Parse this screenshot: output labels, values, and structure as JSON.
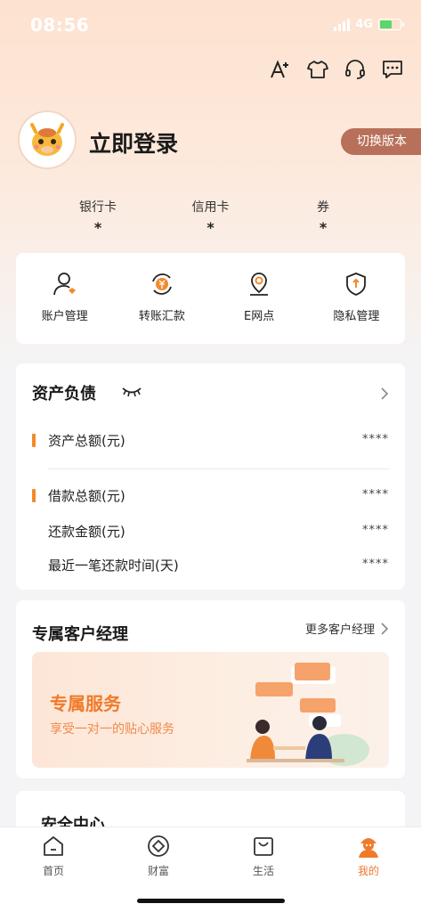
{
  "status_bar": {
    "time": "08:56",
    "network": "4G"
  },
  "profile": {
    "login_title": "立即登录",
    "switch_version": "切换版本"
  },
  "stats": [
    {
      "label": "银行卡",
      "value": "*"
    },
    {
      "label": "信用卡",
      "value": "*"
    },
    {
      "label": "券",
      "value": "*"
    }
  ],
  "quick_actions": [
    {
      "label": "账户管理",
      "icon": "account-icon"
    },
    {
      "label": "转账汇款",
      "icon": "transfer-icon"
    },
    {
      "label": "E网点",
      "icon": "location-icon"
    },
    {
      "label": "隐私管理",
      "icon": "shield-icon"
    }
  ],
  "assets": {
    "title": "资产负债",
    "rows": [
      {
        "label": "资产总额(元)",
        "value": "****"
      },
      {
        "label": "借款总额(元)",
        "value": "****"
      },
      {
        "label": "还款金额(元)",
        "value": "****"
      },
      {
        "label": "最近一笔还款时间(天)",
        "value": "****"
      }
    ]
  },
  "manager": {
    "title": "专属客户经理",
    "more": "更多客户经理",
    "banner_title": "专属服务",
    "banner_sub": "享受一对一的贴心服务"
  },
  "security": {
    "title": "安全中心"
  },
  "tabs": [
    {
      "label": "首页",
      "icon": "home-icon"
    },
    {
      "label": "财富",
      "icon": "wealth-icon"
    },
    {
      "label": "生活",
      "icon": "shopping-bag-icon"
    },
    {
      "label": "我的",
      "icon": "profile-icon"
    }
  ],
  "colors": {
    "accent": "#f07a2a",
    "switch_bg": "#b8705a"
  }
}
